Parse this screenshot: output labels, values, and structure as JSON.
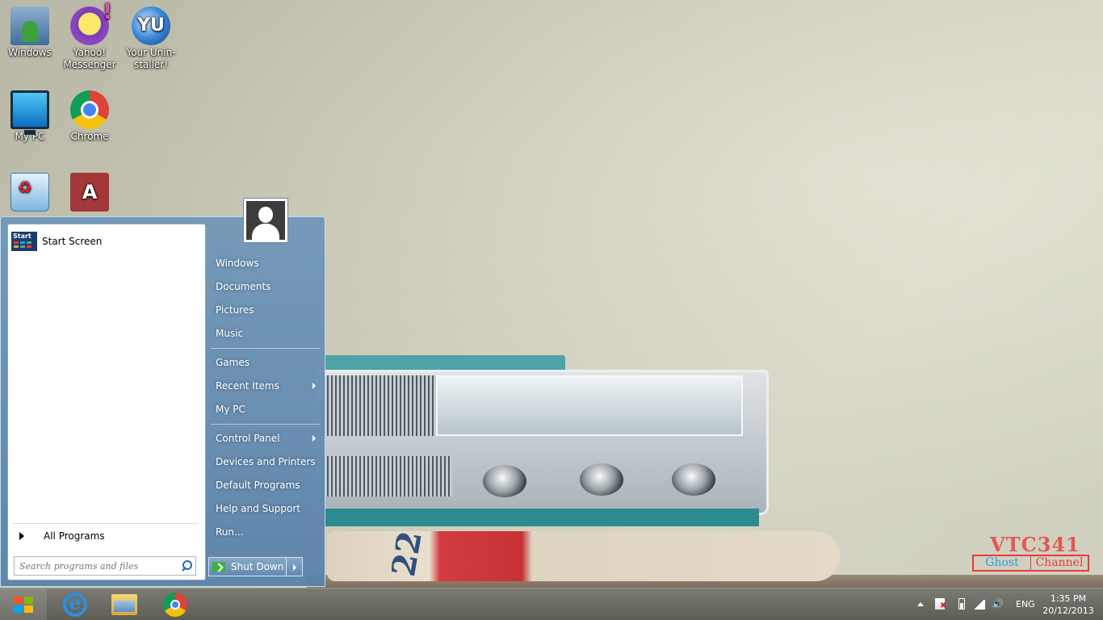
{
  "desktop": {
    "icons": [
      {
        "label": "Windows",
        "icon": "user-folder-icon"
      },
      {
        "label": "Yahoo! Messenger",
        "icon": "yahoo-messenger-icon"
      },
      {
        "label": "Your Unin-staller!",
        "icon": "uninstaller-icon"
      },
      {
        "label": "My PC",
        "icon": "computer-icon"
      },
      {
        "label": "Chrome",
        "icon": "chrome-icon"
      },
      {
        "label": "",
        "icon": "recycle-bin-icon"
      },
      {
        "label": "",
        "icon": "access-icon"
      }
    ],
    "uninstaller_mark": "YU",
    "access_mark": "A"
  },
  "wallpaper": {
    "paper_mark": "22",
    "watermark_top": "VTC341",
    "watermark_left": "Ghost",
    "watermark_right": "Channel"
  },
  "start_menu": {
    "pinned": [
      {
        "label": "Start Screen",
        "tile_text": "Start"
      }
    ],
    "all_programs": "All Programs",
    "search_placeholder": "Search programs and files",
    "right_items": [
      {
        "label": "Windows",
        "has_submenu": false
      },
      {
        "label": "Documents",
        "has_submenu": false
      },
      {
        "label": "Pictures",
        "has_submenu": false
      },
      {
        "label": "Music",
        "has_submenu": false
      },
      {
        "label": "Games",
        "has_submenu": false
      },
      {
        "label": "Recent Items",
        "has_submenu": true
      },
      {
        "label": "My PC",
        "has_submenu": false
      },
      {
        "label": "Control Panel",
        "has_submenu": true
      },
      {
        "label": "Devices and Printers",
        "has_submenu": false
      },
      {
        "label": "Default Programs",
        "has_submenu": false
      },
      {
        "label": "Help and Support",
        "has_submenu": false
      },
      {
        "label": "Run...",
        "has_submenu": false
      }
    ],
    "shutdown_label": "Shut Down"
  },
  "taskbar": {
    "apps": [
      "internet-explorer-icon",
      "file-explorer-icon",
      "chrome-icon"
    ],
    "language": "ENG",
    "time": "1:35 PM",
    "date": "20/12/2013"
  },
  "colors": {
    "windows_logo": [
      "#f35325",
      "#81bc06",
      "#05a6f0",
      "#ffba08"
    ],
    "start_tile_bars": [
      "#e83a3a",
      "#2c9ed8",
      "#41b86b",
      "#d4b03a"
    ]
  }
}
